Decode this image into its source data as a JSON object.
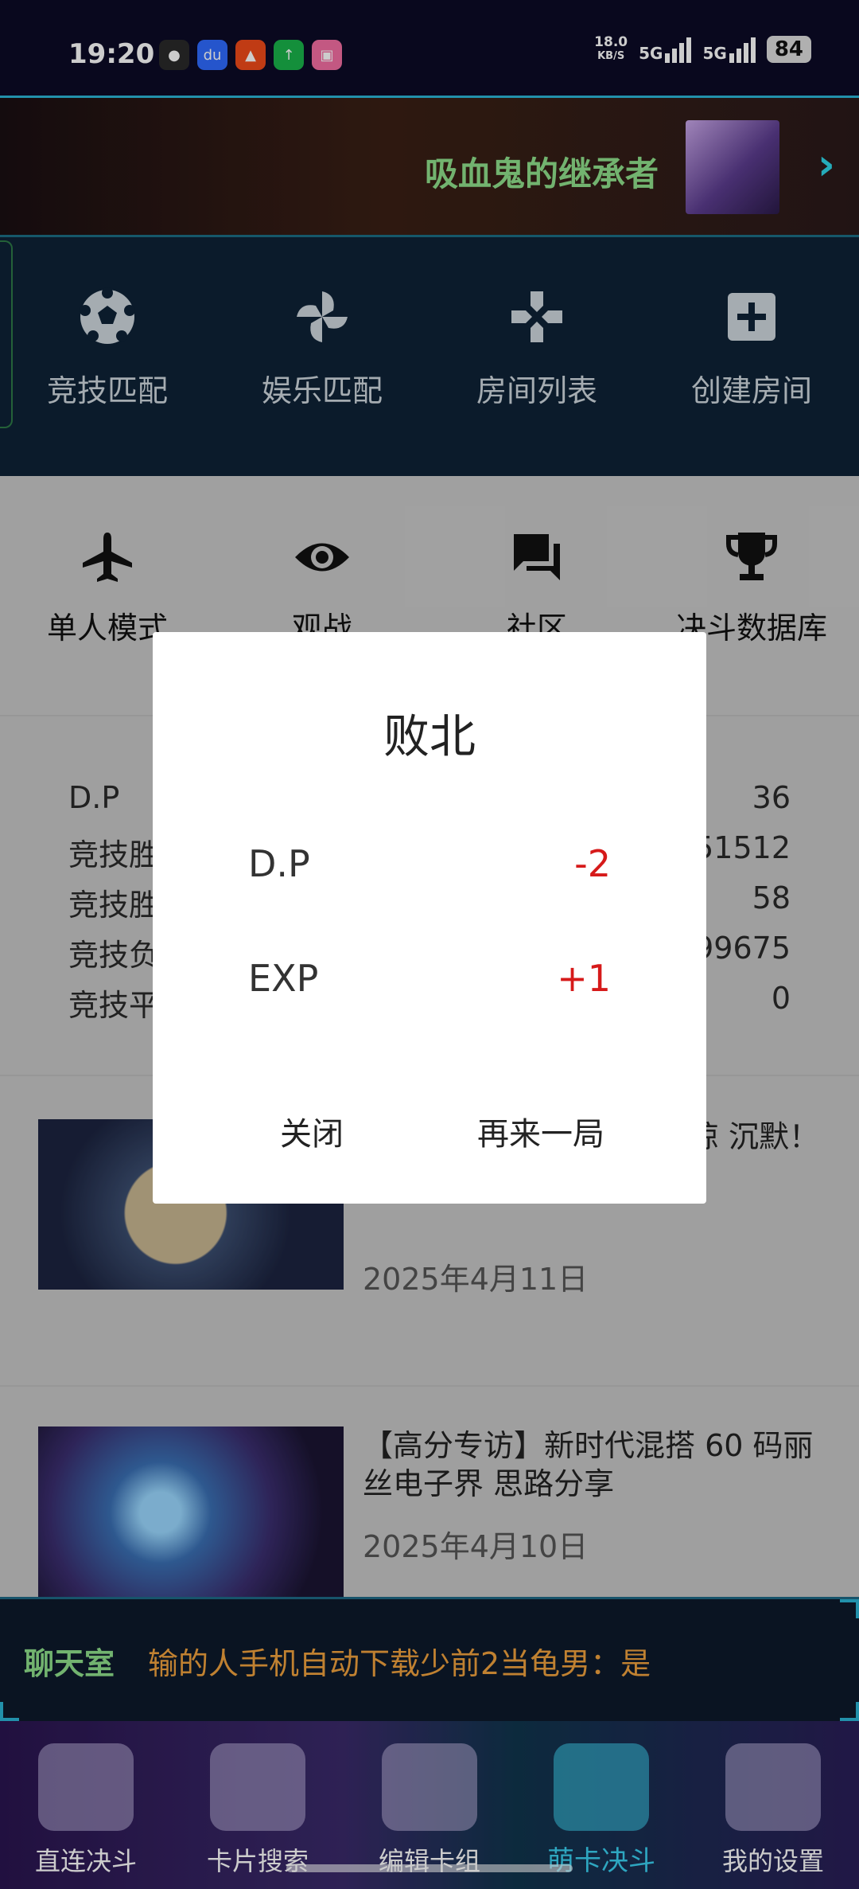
{
  "status_bar": {
    "time": "19:20",
    "net_speed_value": "18.0",
    "net_speed_unit": "KB/S",
    "net1": "5G",
    "net2": "5G",
    "battery": "84"
  },
  "banner": {
    "title": "吸血鬼的继承者"
  },
  "top_menu": [
    {
      "label": "竞技匹配",
      "icon": "soccer-ball-icon"
    },
    {
      "label": "娱乐匹配",
      "icon": "pinwheel-icon"
    },
    {
      "label": "房间列表",
      "icon": "gamepad-icon"
    },
    {
      "label": "创建房间",
      "icon": "plus-box-icon"
    }
  ],
  "second_menu": [
    {
      "label": "单人模式",
      "icon": "airplane-icon"
    },
    {
      "label": "观战",
      "icon": "eye-icon"
    },
    {
      "label": "社区",
      "icon": "chat-icon"
    },
    {
      "label": "决斗数据库",
      "icon": "trophy-icon"
    }
  ],
  "stats": [
    {
      "label": "D.P",
      "value": "36"
    },
    {
      "label": "竞技胜",
      "value": "51512"
    },
    {
      "label": "竞技胜",
      "value": "58"
    },
    {
      "label": "竞技负",
      "value": "99675"
    },
    {
      "label": "竞技平",
      "value": "0"
    }
  ],
  "news": [
    {
      "title": "C教你 手震惊 沉默！",
      "date": "2025年4月11日"
    },
    {
      "title": "【高分专访】新时代混搭 60 码丽丝电子界 思路分享",
      "date": "2025年4月10日"
    }
  ],
  "chat": {
    "label": "聊天室",
    "message": "输的人手机自动下载少前2当龟男：是"
  },
  "bottom_nav": [
    {
      "label": "直连决斗",
      "active": false
    },
    {
      "label": "卡片搜索",
      "active": false
    },
    {
      "label": "编辑卡组",
      "active": false
    },
    {
      "label": "萌卡决斗",
      "active": true
    },
    {
      "label": "我的设置",
      "active": false
    }
  ],
  "dialog": {
    "title": "败北",
    "rows": [
      {
        "label": "D.P",
        "value": "-2"
      },
      {
        "label": "EXP",
        "value": "+1"
      }
    ],
    "close_label": "关闭",
    "again_label": "再来一局"
  }
}
